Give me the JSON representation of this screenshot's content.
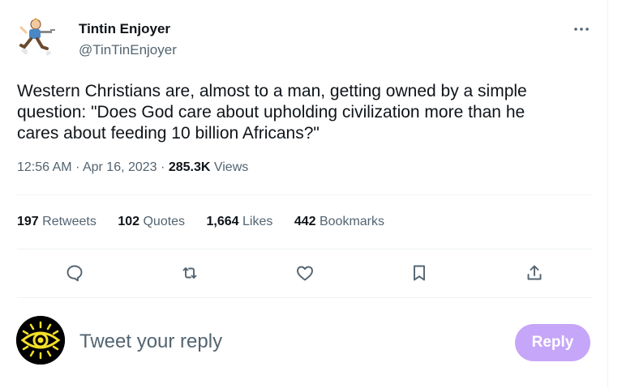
{
  "author": {
    "display_name": "Tintin Enjoyer",
    "handle": "@TinTinEnjoyer",
    "avatar_icon": "tintin-running-avatar"
  },
  "menu": {
    "icon": "more-icon",
    "label": "•••"
  },
  "tweet": {
    "text": "Western Christians are, almost to a man, getting owned by a simple\nquestion: \"Does God care about upholding civilization more than he\ncares about feeding 10 billion Africans?\"",
    "time": "12:56 AM",
    "date": "Apr 16, 2023",
    "views_count": "285.3K",
    "views_label": "Views"
  },
  "stats": [
    {
      "count": "197",
      "label": "Retweets"
    },
    {
      "count": "102",
      "label": "Quotes"
    },
    {
      "count": "1,664",
      "label": "Likes"
    },
    {
      "count": "442",
      "label": "Bookmarks"
    }
  ],
  "actions": [
    "reply-icon",
    "retweet-icon",
    "like-icon",
    "bookmark-icon",
    "share-icon"
  ],
  "reply_box": {
    "placeholder": "Tweet your reply",
    "button_label": "Reply",
    "avatar_icon": "eye-avatar"
  },
  "colors": {
    "text_primary": "#0f1419",
    "text_secondary": "#536471",
    "divider": "#eff3f4",
    "reply_button_disabled": "#c6a6f8",
    "eye_yellow": "#f4e027"
  }
}
